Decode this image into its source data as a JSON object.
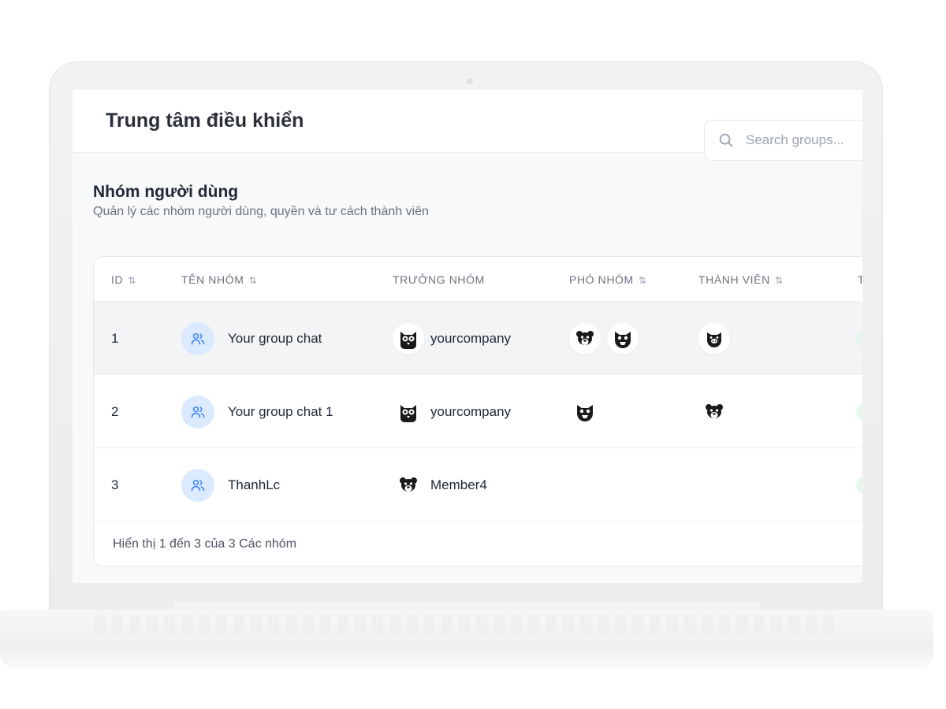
{
  "app": {
    "title": "Trung tâm điều khiển"
  },
  "section": {
    "title": "Nhóm người dùng",
    "subtitle": "Quản lý các nhóm người dùng, quyền và tư cách thành viên"
  },
  "search": {
    "placeholder": "Search groups..."
  },
  "table": {
    "columns": [
      {
        "label": "ID",
        "sortable": true
      },
      {
        "label": "TÊN NHÓM",
        "sortable": true
      },
      {
        "label": "TRƯỞNG NHÓM",
        "sortable": false
      },
      {
        "label": "PHÓ NHÓM",
        "sortable": true
      },
      {
        "label": "THÀNH VIÊN",
        "sortable": true
      },
      {
        "label": "T",
        "sortable": false
      }
    ],
    "sort_icon": "⇅",
    "rows": [
      {
        "id": "1",
        "name": "Your group chat",
        "leader": "yourcompany",
        "deputies": [
          "bear-avatar-icon",
          "cat-avatar-icon"
        ],
        "members": [
          "pig-avatar-icon"
        ]
      },
      {
        "id": "2",
        "name": "Your group chat 1",
        "leader": "yourcompany",
        "deputies": [
          "cat-avatar-icon"
        ],
        "members": [
          "bear-avatar-icon"
        ]
      },
      {
        "id": "3",
        "name": "ThanhLc",
        "leader": "Member4",
        "deputies": [],
        "members": []
      }
    ],
    "footer": "Hiển thị 1 đến 3 của 3 Các nhóm"
  },
  "colors": {
    "accent": "#3b82f6",
    "group_icon_bg": "#dbeafe",
    "status_bg": "#e7f6ec"
  }
}
